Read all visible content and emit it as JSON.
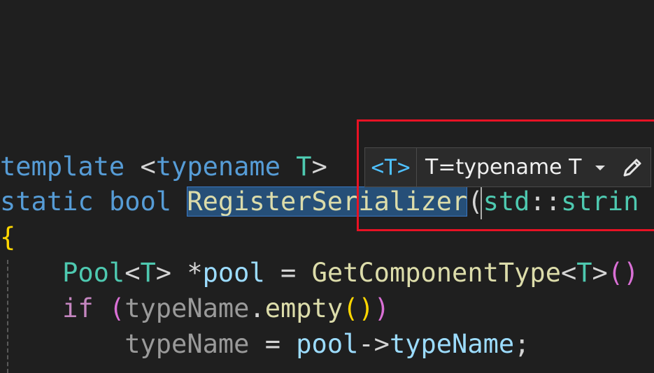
{
  "code": {
    "line1": {
      "template_kw": "template",
      "open_angle": " <",
      "typename_kw": "typename",
      "space": " ",
      "type_param": "T",
      "close_angle": ">"
    },
    "line2": {
      "static_kw": "static",
      "space1": " ",
      "bool_kw": "bool",
      "space2": " ",
      "function_name": "RegisterSerializer",
      "open_paren": "(",
      "std_ns": "std",
      "scope_op": "::",
      "type_cut": "strin"
    },
    "line3": {
      "brace": "{"
    },
    "line4": {
      "indent": "    ",
      "pool_type": "Pool",
      "lt": "<",
      "t": "T",
      "gt": ">",
      "star_space": " *",
      "pool_var": "pool",
      "assign": " = ",
      "func": "GetComponentType",
      "lt2": "<",
      "t2": "T",
      "gt2": ">",
      "parens": "()"
    },
    "line5": {
      "indent": "    ",
      "if_kw": "if",
      "space": " ",
      "open_paren": "(",
      "param": "typeName",
      "dot": ".",
      "method": "empty",
      "call_parens": "()",
      "close_paren": ")"
    },
    "line6": {
      "indent": "        ",
      "param": "typeName",
      "assign": " = ",
      "pool_var": "pool",
      "arrow": "->",
      "member": "typeName",
      "semicolon": ";"
    }
  },
  "template_hint": {
    "tag_label": "<T>",
    "selected_value": "T=typename T",
    "dropdown_icon": "chevron-down-icon",
    "edit_icon": "pencil-icon"
  },
  "colors": {
    "background": "#1f1f1f",
    "keyword": "#569cd6",
    "control_keyword": "#c586c0",
    "type": "#4ec9b0",
    "function": "#dcdcaa",
    "variable": "#9cdcfe",
    "selection": "#264f78",
    "highlight_box": "#e81224"
  }
}
